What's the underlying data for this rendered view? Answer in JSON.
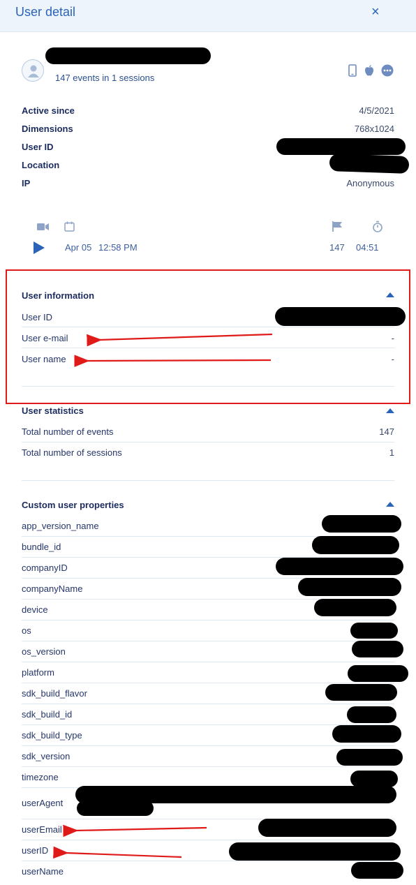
{
  "header": {
    "title": "User detail",
    "close_icon": "×"
  },
  "user": {
    "events_summary": "147 events in 1 sessions"
  },
  "device_icons": [
    "phone-icon",
    "apple-icon",
    "more-icon"
  ],
  "details": [
    {
      "label": "Active since",
      "value": "4/5/2021"
    },
    {
      "label": "Dimensions",
      "value": "768x1024"
    },
    {
      "label": "User ID",
      "value": ""
    },
    {
      "label": "Location",
      "value": ""
    },
    {
      "label": "IP",
      "value": "Anonymous"
    }
  ],
  "session": {
    "date": "Apr 05",
    "time": "12:58 PM",
    "events": "147",
    "duration": "04:51"
  },
  "user_information": {
    "title": "User information",
    "rows": [
      {
        "label": "User ID",
        "value": ""
      },
      {
        "label": "User e-mail",
        "value": "-"
      },
      {
        "label": "User name",
        "value": "-"
      }
    ]
  },
  "user_statistics": {
    "title": "User statistics",
    "rows": [
      {
        "label": "Total number of events",
        "value": "147"
      },
      {
        "label": "Total number of sessions",
        "value": "1"
      }
    ]
  },
  "custom_properties": {
    "title": "Custom user properties",
    "rows": [
      {
        "label": "app_version_name"
      },
      {
        "label": "bundle_id"
      },
      {
        "label": "companyID"
      },
      {
        "label": "companyName"
      },
      {
        "label": "device"
      },
      {
        "label": "os"
      },
      {
        "label": "os_version"
      },
      {
        "label": "platform"
      },
      {
        "label": "sdk_build_flavor"
      },
      {
        "label": "sdk_build_id"
      },
      {
        "label": "sdk_build_type"
      },
      {
        "label": "sdk_version"
      },
      {
        "label": "timezone"
      },
      {
        "label": "userAgent"
      },
      {
        "label": "userEmail"
      },
      {
        "label": "userID"
      },
      {
        "label": "userName"
      }
    ]
  },
  "colors": {
    "accent": "#2a63b8",
    "annotation": "#e01919"
  }
}
